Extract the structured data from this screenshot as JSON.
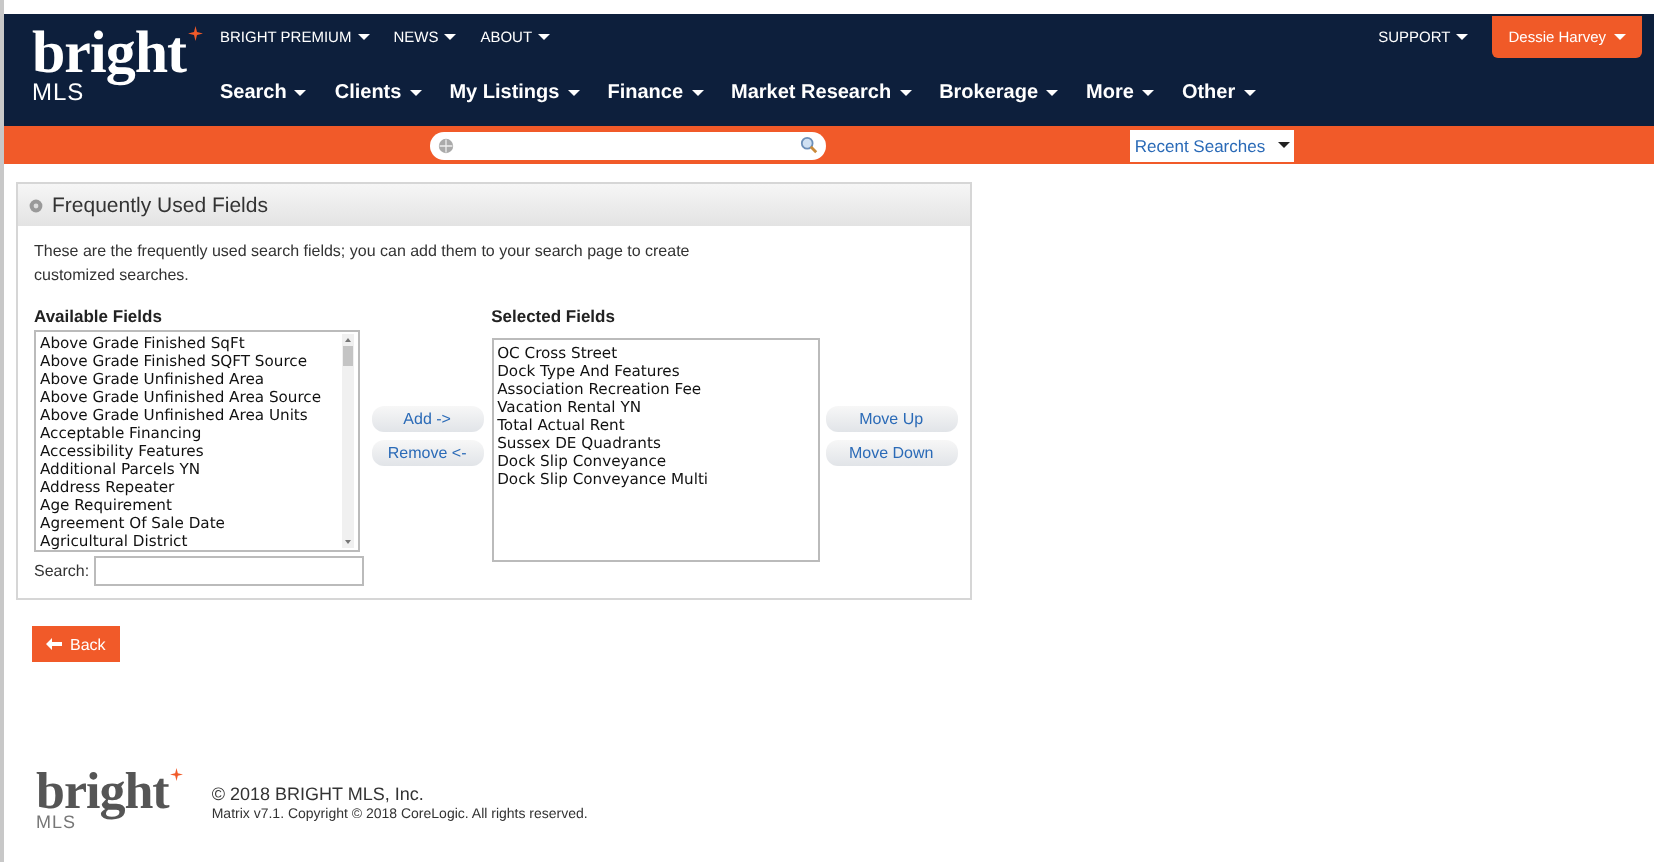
{
  "logo": {
    "wordmark": "bright",
    "sub": "MLS"
  },
  "top_links": [
    {
      "label": "BRIGHT PREMIUM"
    },
    {
      "label": "NEWS"
    },
    {
      "label": "ABOUT"
    }
  ],
  "utility": {
    "support": "SUPPORT",
    "user": "Dessie Harvey"
  },
  "main_nav": [
    {
      "label": "Search"
    },
    {
      "label": "Clients"
    },
    {
      "label": "My Listings"
    },
    {
      "label": "Finance"
    },
    {
      "label": "Market Research"
    },
    {
      "label": "Brokerage"
    },
    {
      "label": "More"
    },
    {
      "label": "Other"
    }
  ],
  "recent_searches": "Recent Searches",
  "panel": {
    "title": "Frequently Used Fields",
    "description": "These are the frequently used search fields; you can add them to your search page to create customized searches.",
    "available": {
      "label": "Available Fields",
      "items": [
        "Above Grade Finished SqFt",
        "Above Grade Finished SQFT Source",
        "Above Grade Unfinished Area",
        "Above Grade Unfinished Area Source",
        "Above Grade Unfinished Area Units",
        "Acceptable Financing",
        "Accessibility Features",
        "Additional Parcels YN",
        "Address Repeater",
        "Age Requirement",
        "Agreement Of Sale Date",
        "Agricultural District"
      ]
    },
    "search_label": "Search:",
    "transfer_buttons": [
      "Add ->",
      "Remove <-"
    ],
    "selected": {
      "label": "Selected Fields",
      "items": [
        "OC Cross Street",
        "Dock Type And Features",
        "Association Recreation Fee",
        "Vacation Rental YN",
        "Total Actual Rent",
        "Sussex DE Quadrants",
        "Dock Slip Conveyance",
        "Dock Slip Conveyance Multi"
      ]
    },
    "order_buttons": [
      "Move Up",
      "Move Down"
    ]
  },
  "back": "Back",
  "footer": {
    "logo": {
      "wordmark": "bright",
      "sub": "MLS"
    },
    "line_1": "© 2018 BRIGHT MLS, Inc.",
    "line_2": "Matrix v7.1. Copyright © 2018 CoreLogic. All rights reserved."
  }
}
